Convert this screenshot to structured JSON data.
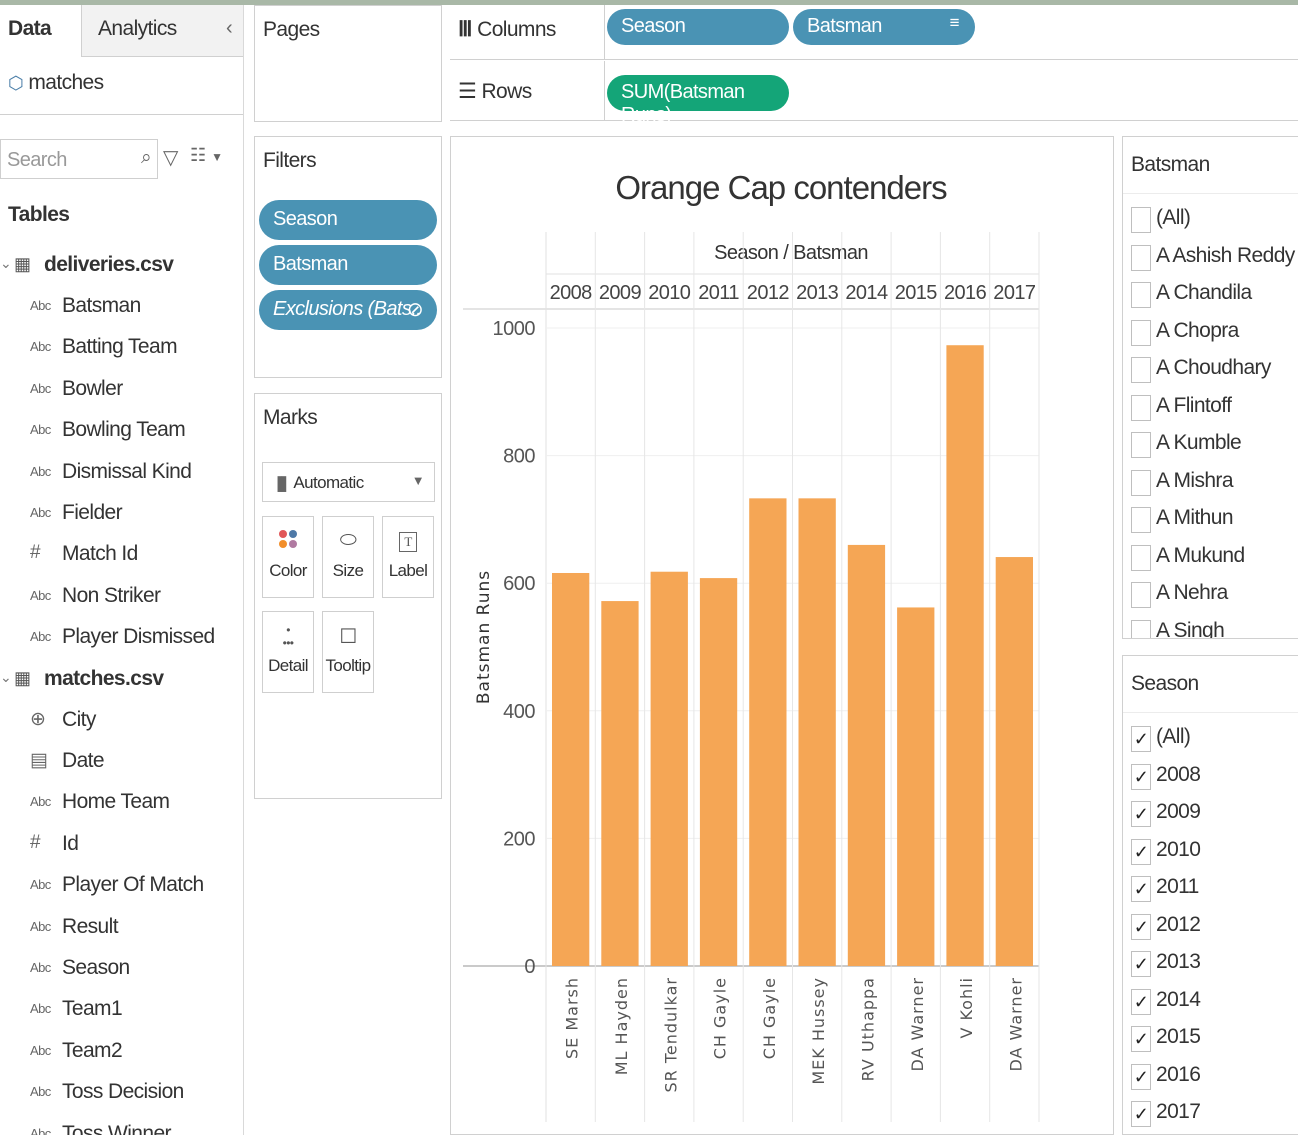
{
  "left_pane": {
    "tabs": [
      "Data",
      "Analytics"
    ],
    "collapse_icon": "chevron-left-icon",
    "datasource": "matches",
    "search_placeholder": "Search",
    "tables_heading": "Tables",
    "tables": [
      {
        "name": "deliveries.csv",
        "fields": [
          {
            "type": "Abc",
            "name": "Batsman"
          },
          {
            "type": "Abc",
            "name": "Batting Team"
          },
          {
            "type": "Abc",
            "name": "Bowler"
          },
          {
            "type": "Abc",
            "name": "Bowling Team"
          },
          {
            "type": "Abc",
            "name": "Dismissal Kind"
          },
          {
            "type": "Abc",
            "name": "Fielder"
          },
          {
            "type": "#",
            "name": "Match Id"
          },
          {
            "type": "Abc",
            "name": "Non Striker"
          },
          {
            "type": "Abc",
            "name": "Player Dismissed"
          }
        ]
      },
      {
        "name": "matches.csv",
        "fields": [
          {
            "type": "geo",
            "name": "City"
          },
          {
            "type": "date",
            "name": "Date"
          },
          {
            "type": "Abc",
            "name": "Home Team"
          },
          {
            "type": "#",
            "name": "Id"
          },
          {
            "type": "Abc",
            "name": "Player Of Match"
          },
          {
            "type": "Abc",
            "name": "Result"
          },
          {
            "type": "Abc",
            "name": "Season"
          },
          {
            "type": "Abc",
            "name": "Team1"
          },
          {
            "type": "Abc",
            "name": "Team2"
          },
          {
            "type": "Abc",
            "name": "Toss Decision"
          },
          {
            "type": "Abc",
            "name": "Toss Winner"
          }
        ]
      }
    ]
  },
  "pages": {
    "title": "Pages"
  },
  "columns_shelf": {
    "label": "Columns",
    "pills": [
      "Season",
      "Batsman"
    ]
  },
  "rows_shelf": {
    "label": "Rows",
    "pills": [
      "SUM(Batsman Runs)"
    ]
  },
  "filters": {
    "title": "Filters",
    "pills": [
      "Season",
      "Batsman",
      "Exclusions (Bats.."
    ]
  },
  "marks": {
    "title": "Marks",
    "type": "Automatic",
    "buttons": [
      "Color",
      "Size",
      "Label",
      "Detail",
      "Tooltip"
    ]
  },
  "chart_data": {
    "type": "bar",
    "title": "Orange Cap contenders",
    "column_header": "Season / Batsman",
    "seasons": [
      "2008",
      "2009",
      "2010",
      "2011",
      "2012",
      "2013",
      "2014",
      "2015",
      "2016",
      "2017"
    ],
    "categories": [
      "SE Marsh",
      "ML Hayden",
      "SR Tendulkar",
      "CH Gayle",
      "CH Gayle",
      "MEK Hussey",
      "RV Uthappa",
      "DA Warner",
      "V Kohli",
      "DA Warner"
    ],
    "values": [
      616,
      572,
      618,
      608,
      733,
      733,
      660,
      562,
      973,
      641
    ],
    "ylabel": "Batsman Runs",
    "yticks": [
      0,
      200,
      400,
      600,
      800,
      1000
    ],
    "ylim": [
      0,
      1000
    ],
    "bar_color": "#f5a655"
  },
  "batsman_filter": {
    "title": "Batsman",
    "items": [
      "(All)",
      "A Ashish Reddy",
      "A Chandila",
      "A Chopra",
      "A Choudhary",
      "A Flintoff",
      "A Kumble",
      "A Mishra",
      "A Mithun",
      "A Mukund",
      "A Nehra",
      "A Singh"
    ]
  },
  "season_filter": {
    "title": "Season",
    "items": [
      "(All)",
      "2008",
      "2009",
      "2010",
      "2011",
      "2012",
      "2013",
      "2014",
      "2015",
      "2016",
      "2017"
    ],
    "check_mark": "✓"
  }
}
